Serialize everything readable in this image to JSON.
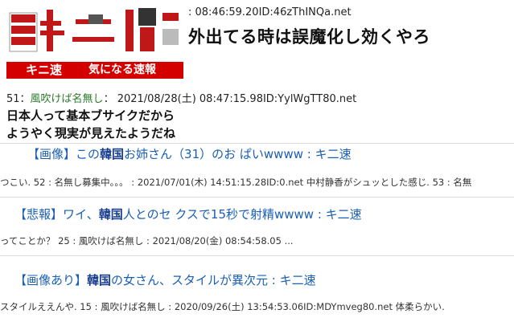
{
  "logo": {
    "mark": "キ二",
    "site_name": "キニ速",
    "tagline": "気になる速報"
  },
  "post1": {
    "meta_tail": ": 08:46:59.20ID:46zThINQa.net",
    "text_tail": "外出てる時は誤魔化し効くやろ"
  },
  "post2": {
    "number": "51：",
    "name": "風吹けば名無し",
    "meta_rest": "：  2021/08/28(土) 08:47:15.98ID:YylWgTT80.net",
    "line1": "日本人って基本ブサイクだから",
    "line2": "ようやく現実が見えたようだね"
  },
  "related": [
    {
      "tag": "【画像】",
      "pre": "この",
      "highlight": "韓国",
      "post": "お姉さん（31）のお ぱいwwww : キ二速",
      "snippet": "つこい. 52 : 名無し募集中。。。 :  2021/07/01(木) 14:51:15.28ID:0.net 中村静香がシュッとした感じ. 53 : 名無"
    },
    {
      "tag": "【悲報】",
      "pre": "ワイ、",
      "highlight": "韓国",
      "post": "人とのセ クスで15秒で射精wwww : キ二速",
      "snippet": "ってことか？ 25 : 風吹けば名無し :  2021/08/20(金) 08:54:58.05 ..."
    },
    {
      "tag": "【画像あり】",
      "pre": "",
      "highlight": "韓国",
      "post": "の女さん、スタイルが異次元 : キ二速",
      "snippet": "スタイルええんや. 15 : 風吹けば名無し :  2020/09/26(土) 13:54:53.06ID:MDYmveg80.net 体柔らかい."
    }
  ],
  "colors": {
    "brand_red": "#d40000",
    "link_blue": "#1a5fb4",
    "name_green": "#2a7a2a"
  }
}
